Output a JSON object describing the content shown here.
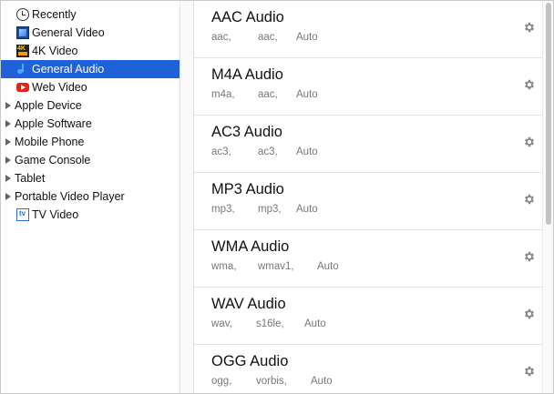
{
  "sidebar": {
    "items": [
      {
        "label": "Recently",
        "icon": "clock-icon"
      },
      {
        "label": "General Video",
        "icon": "film-icon"
      },
      {
        "label": "4K Video",
        "icon": "4k-icon"
      },
      {
        "label": "General Audio",
        "icon": "music-note-icon",
        "selected": true
      },
      {
        "label": "Web Video",
        "icon": "youtube-icon"
      },
      {
        "label": "Apple Device",
        "group": true
      },
      {
        "label": "Apple Software",
        "group": true
      },
      {
        "label": "Mobile Phone",
        "group": true
      },
      {
        "label": "Game Console",
        "group": true
      },
      {
        "label": "Tablet",
        "group": true
      },
      {
        "label": "Portable Video Player",
        "group": true
      },
      {
        "label": "TV Video",
        "icon": "tv-icon"
      }
    ]
  },
  "formats": [
    {
      "name": "AAC Audio",
      "ext": "aac,",
      "codec": "aac,",
      "quality": "Auto"
    },
    {
      "name": "M4A Audio",
      "ext": "m4a,",
      "codec": "aac,",
      "quality": "Auto"
    },
    {
      "name": "AC3 Audio",
      "ext": "ac3,",
      "codec": "ac3,",
      "quality": "Auto"
    },
    {
      "name": "MP3 Audio",
      "ext": "mp3,",
      "codec": "mp3,",
      "quality": "Auto"
    },
    {
      "name": "WMA Audio",
      "ext": "wma,",
      "codec": "wmav1,",
      "quality": "Auto"
    },
    {
      "name": "WAV Audio",
      "ext": "wav,",
      "codec": "s16le,",
      "quality": "Auto"
    },
    {
      "name": "OGG Audio",
      "ext": "ogg,",
      "codec": "vorbis,",
      "quality": "Auto"
    }
  ],
  "colors": {
    "selection": "#1f62d8",
    "gear": "#8a8a8a"
  }
}
